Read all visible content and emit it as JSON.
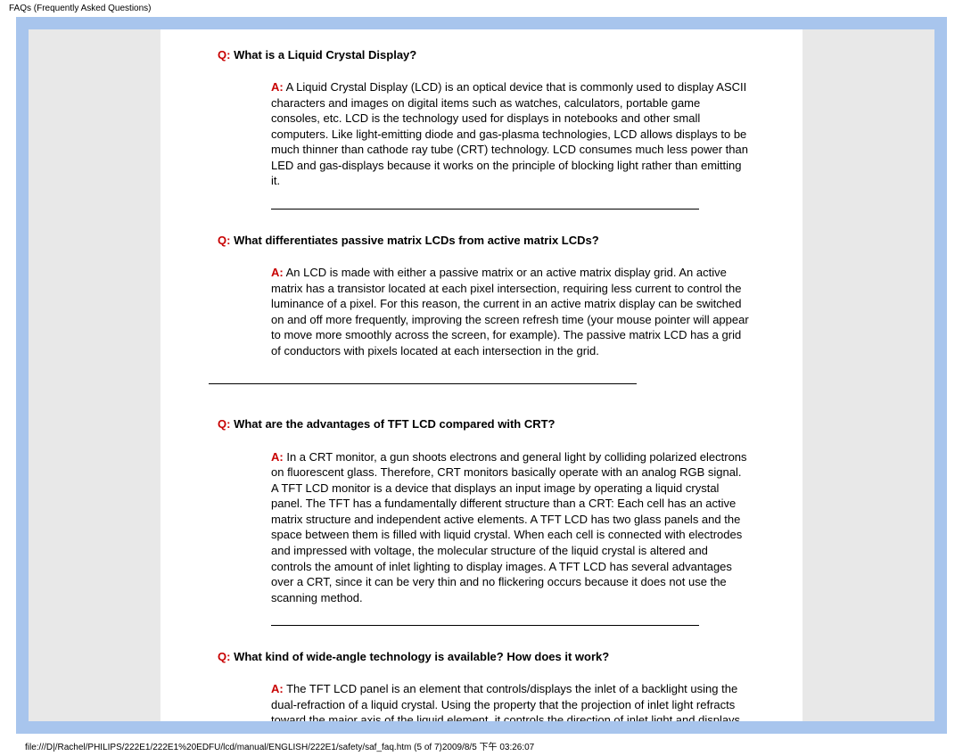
{
  "header": {
    "title": "FAQs (Frequently Asked Questions)"
  },
  "faqs": [
    {
      "q_prefix": "Q:",
      "q_text": " What is a Liquid Crystal Display?",
      "a_prefix": "A:",
      "a_text": " A Liquid Crystal Display (LCD) is an optical device that is commonly used to display ASCII characters and images on digital items such as watches, calculators, portable game consoles, etc. LCD is the technology used for displays in notebooks and other small computers. Like light-emitting diode and gas-plasma technologies, LCD allows displays to be much thinner than cathode ray tube (CRT) technology. LCD consumes much less power than LED and gas-displays because it works on the principle of blocking light rather than emitting it.",
      "hr_class": "hr"
    },
    {
      "q_prefix": "Q:",
      "q_text": " What differentiates passive matrix LCDs from active matrix LCDs?",
      "a_prefix": "A:",
      "a_text": " An LCD is made with either a passive matrix or an active matrix display grid. An active matrix has a transistor located at each pixel intersection, requiring less current to control the luminance of a pixel. For this reason, the current in an active matrix display can be switched on and off more frequently, improving the screen refresh time (your mouse pointer will appear to move more smoothly across the screen, for example). The passive matrix LCD has a grid of conductors with pixels located at each intersection in the grid.",
      "hr_class": "hr-alt"
    },
    {
      "q_prefix": "Q:",
      "q_text": " What are the advantages of TFT LCD compared with CRT?",
      "a_prefix": "A:",
      "a_text": " In a CRT monitor, a gun shoots electrons and general light by colliding polarized electrons on fluorescent glass. Therefore, CRT monitors basically operate with an analog RGB signal. A TFT LCD monitor is a device that displays an input image by operating a liquid crystal panel. The TFT has a fundamentally different structure than a CRT: Each cell has an active matrix structure and independent active elements. A TFT LCD has two glass panels and the space between them is filled with liquid crystal. When each cell is connected with electrodes and impressed with voltage, the molecular structure of the liquid crystal is altered and controls the amount of inlet lighting to display images. A TFT LCD has several advantages over a CRT, since it can be very thin and no flickering occurs because it does not use the scanning method.",
      "hr_class": "hr"
    },
    {
      "q_prefix": "Q:",
      "q_text": " What kind of wide-angle technology is available? How does it work?",
      "a_prefix": "A:",
      "a_text": " The TFT LCD panel is an element that controls/displays the inlet of a backlight using the dual-refraction of a liquid crystal. Using the property that the projection of inlet light refracts toward the major axis of the liquid element, it controls the direction of inlet light and displays it. Since the refraction ratio of inlet light on liquid crystal",
      "hr_class": ""
    }
  ],
  "footer": {
    "path": "file:///D|/Rachel/PHILIPS/222E1/222E1%20EDFU/lcd/manual/ENGLISH/222E1/safety/saf_faq.htm (5 of 7)2009/8/5 下午 03:26:07"
  }
}
